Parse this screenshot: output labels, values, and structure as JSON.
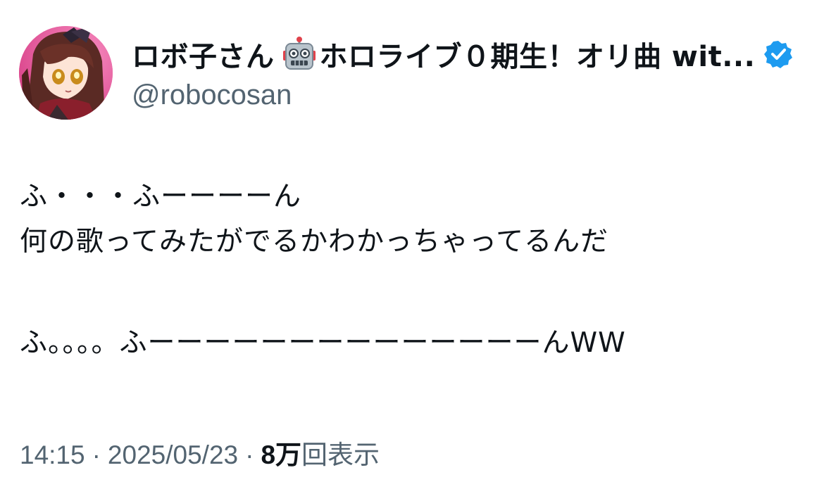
{
  "author": {
    "display_name": "ロボ子さん",
    "name_suffix": "ホロライブ０期生！オリ曲 wit...",
    "handle": "@robocosan",
    "verified": true,
    "verified_color": "#1d9bf0",
    "name_emoji": "robot-face-icon"
  },
  "tweet": {
    "lines": [
      "ふ・・・ふーーーーん",
      "何の歌ってみたがでるかわかっちゃってるんだ",
      "",
      "ふ。。。。ふーーーーーーーーーーーーーーんWW"
    ]
  },
  "meta": {
    "time": "14:15",
    "separator": "·",
    "date": "2025/05/23",
    "views_count": "8万",
    "views_label": "回表示"
  }
}
